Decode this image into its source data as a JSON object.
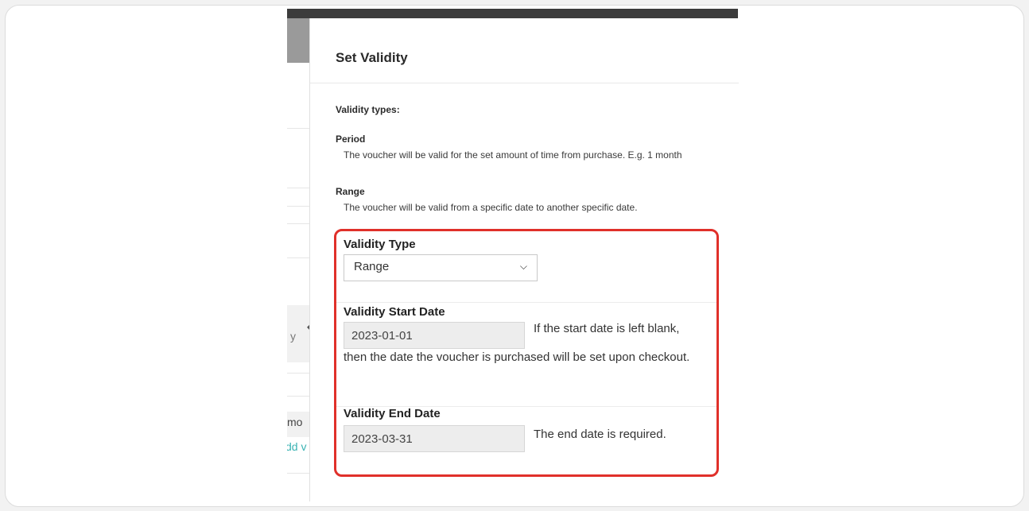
{
  "underlying_page": {
    "fragments": [
      "y",
      "mo",
      "dd v"
    ],
    "link_color": "#3bb3b3"
  },
  "modal": {
    "title": "Set Validity",
    "types_title": "Validity types:",
    "types": [
      {
        "term": "Period",
        "description": "The voucher will be valid for the set amount of time from purchase. E.g. 1 month"
      },
      {
        "term": "Range",
        "description": "The voucher will be valid from a specific date to another specific date."
      }
    ],
    "form": {
      "validity_type": {
        "label": "Validity Type",
        "value": "Range"
      },
      "start_date": {
        "label": "Validity Start Date",
        "value": "2023-01-01",
        "help_first": "If the start date is left blank,",
        "help_rest": "then the date the voucher is purchased will be set upon checkout."
      },
      "end_date": {
        "label": "Validity End Date",
        "value": "2023-03-31",
        "help": "The end date is required."
      }
    },
    "highlight_color": "#e0302a"
  }
}
